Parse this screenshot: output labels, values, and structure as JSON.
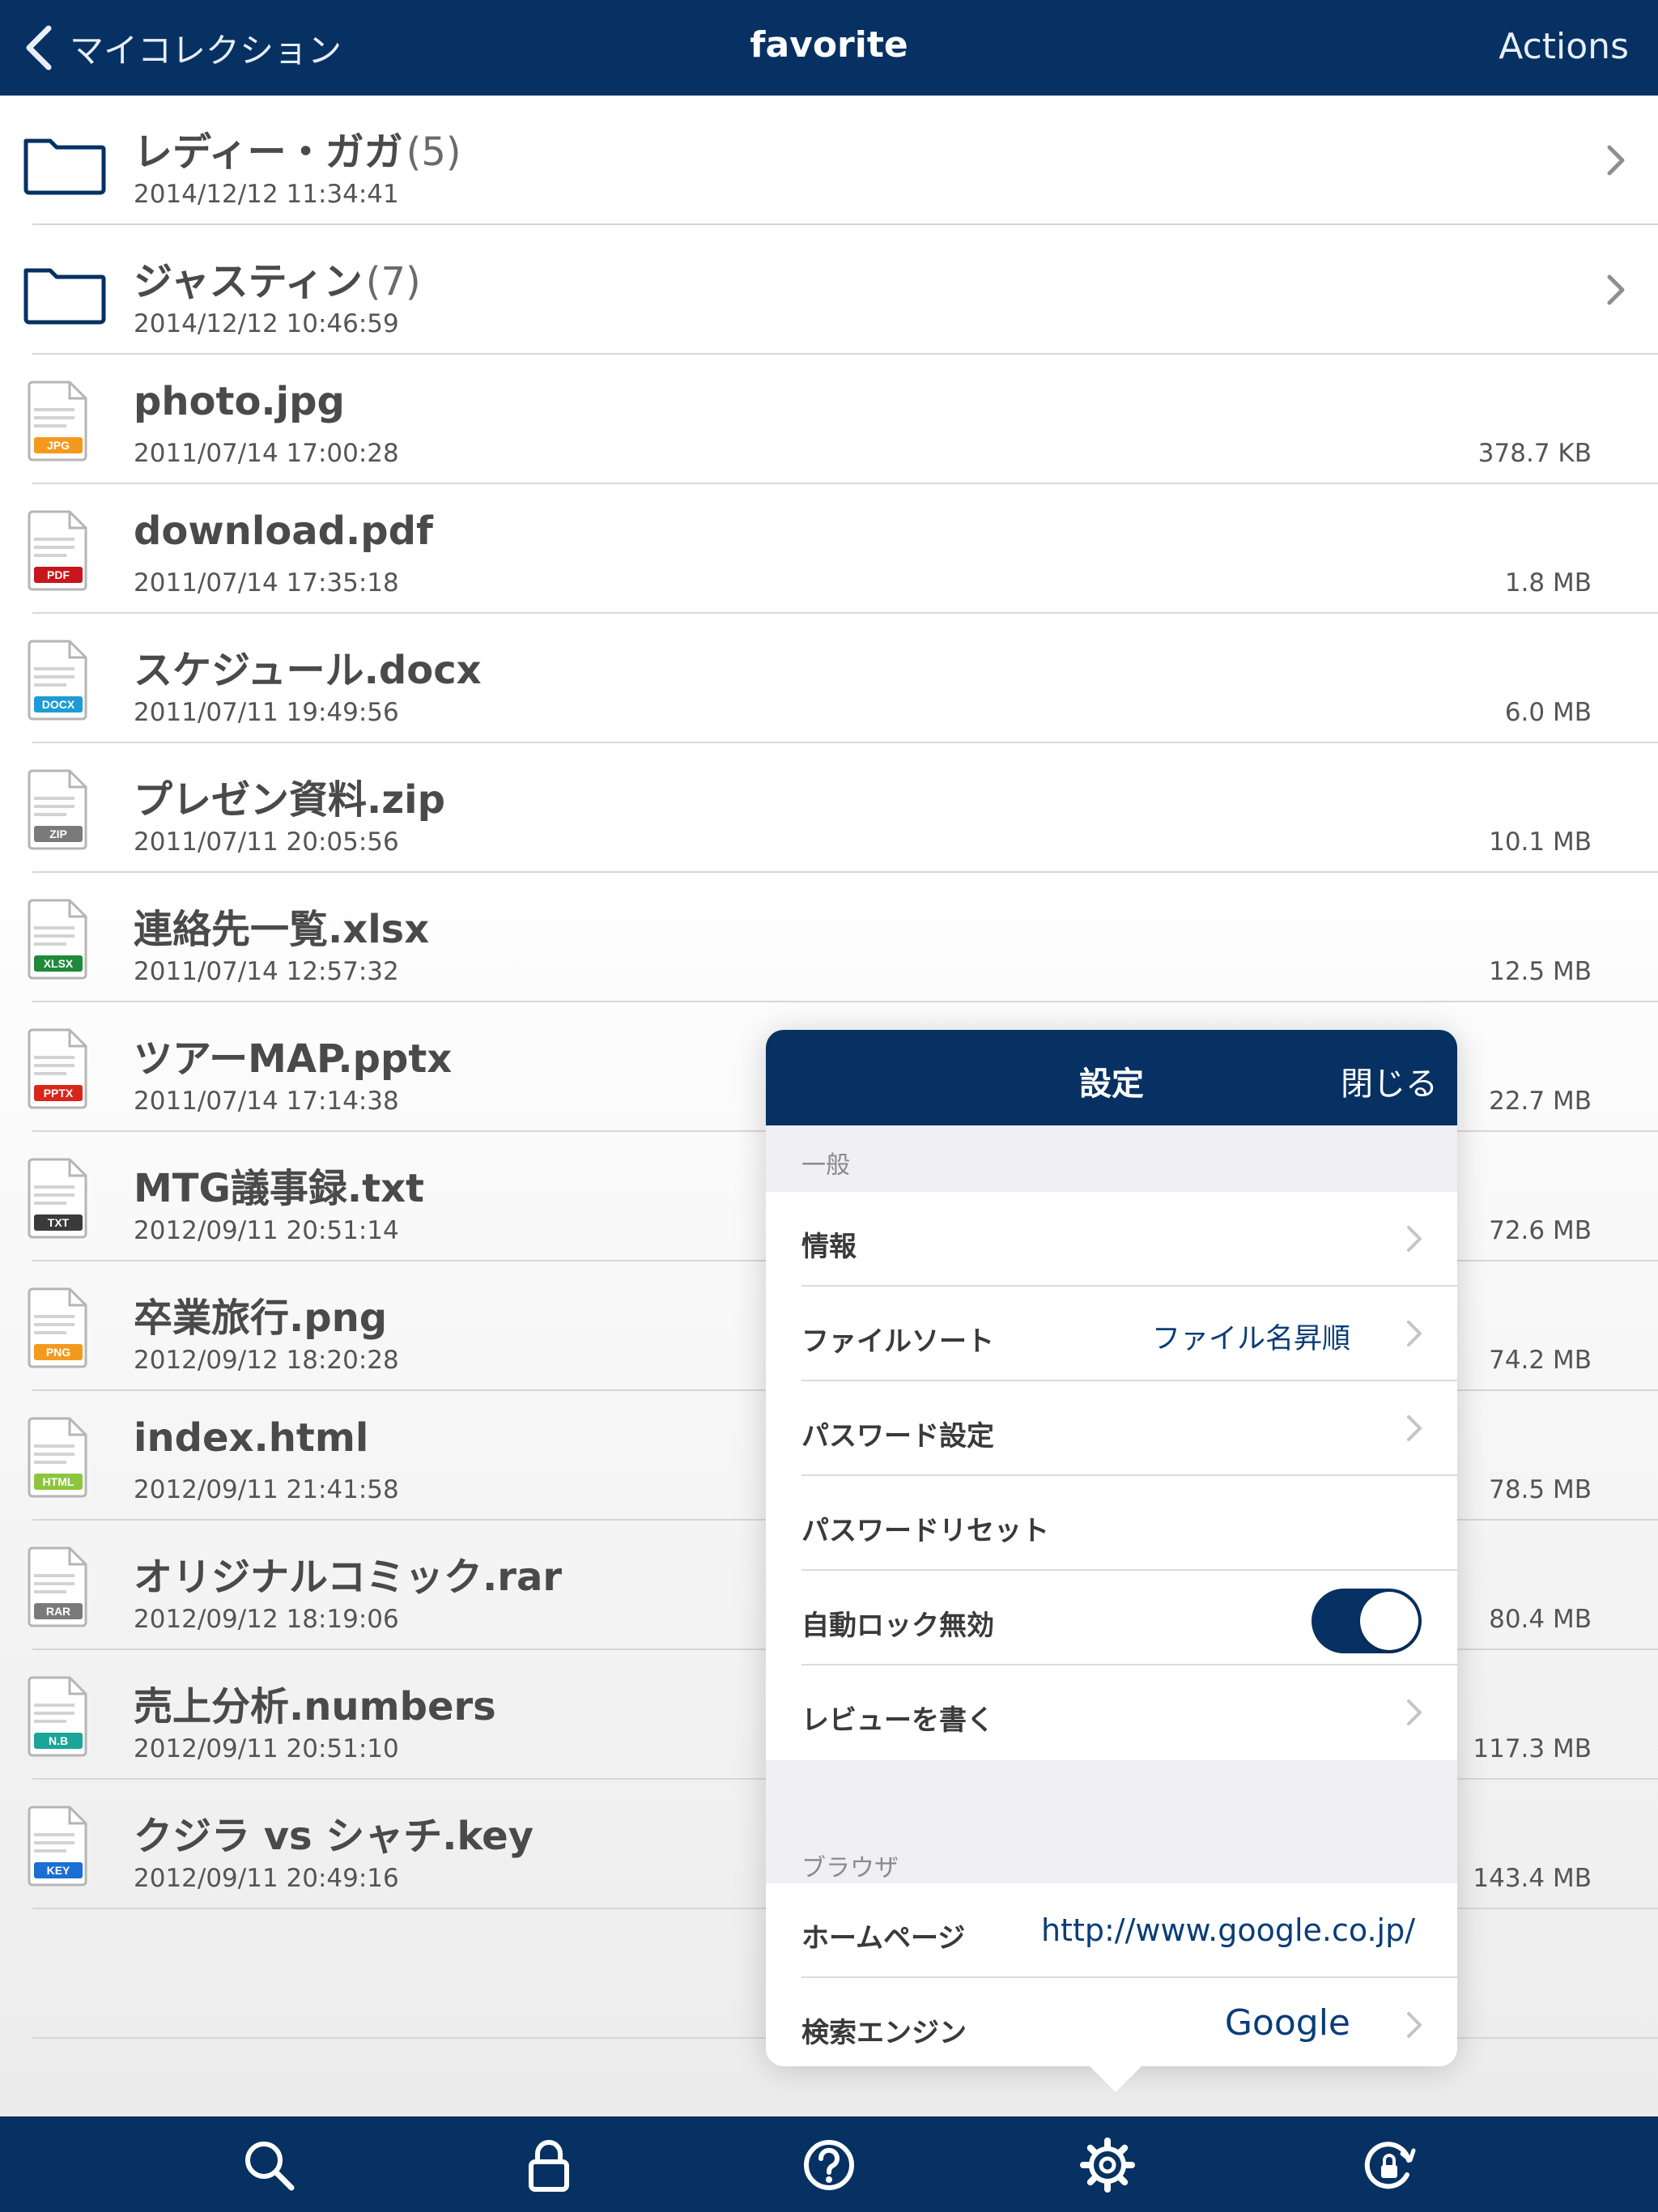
{
  "navbar": {
    "back_label": "マイコレクション",
    "title": "favorite",
    "actions_label": "Actions"
  },
  "items": [
    {
      "kind": "folder",
      "name": "レディー・ガガ",
      "count": "(5)",
      "date": "2014/12/12 11:34:41"
    },
    {
      "kind": "folder",
      "name": "ジャスティン",
      "count": "(7)",
      "date": "2014/12/12 10:46:59"
    },
    {
      "kind": "file",
      "name": "photo.jpg",
      "date": "2011/07/14 17:00:28",
      "size": "378.7 KB",
      "badge": "JPG",
      "badge_color": "#f39a1e",
      "icon": "image-file-icon"
    },
    {
      "kind": "file",
      "name": "download.pdf",
      "date": "2011/07/14 17:35:18",
      "size": "1.8 MB",
      "badge": "PDF",
      "badge_color": "#c8161d",
      "icon": "pdf-file-icon"
    },
    {
      "kind": "file",
      "name": "スケジュール.docx",
      "date": "2011/07/11 19:49:56",
      "size": "6.0 MB",
      "badge": "DOCX",
      "badge_color": "#1e9bd7",
      "icon": "document-file-icon"
    },
    {
      "kind": "file",
      "name": "プレゼン資料.zip",
      "date": "2011/07/11 20:05:56",
      "size": "10.1 MB",
      "badge": "ZIP",
      "badge_color": "#7a7a7a",
      "icon": "zip-file-icon"
    },
    {
      "kind": "file",
      "name": "連絡先一覧.xlsx",
      "date": "2011/07/14 12:57:32",
      "size": "12.5 MB",
      "badge": "XLSX",
      "badge_color": "#1f8a3a",
      "icon": "spreadsheet-file-icon"
    },
    {
      "kind": "file",
      "name": "ツアーMAP.pptx",
      "date": "2011/07/14 17:14:38",
      "size": "22.7 MB",
      "badge": "PPTX",
      "badge_color": "#d9261c",
      "icon": "presentation-file-icon"
    },
    {
      "kind": "file",
      "name": "MTG議事録.txt",
      "date": "2012/09/11 20:51:14",
      "size": "72.6 MB",
      "badge": "TXT",
      "badge_color": "#3a3a3a",
      "icon": "text-file-icon"
    },
    {
      "kind": "file",
      "name": "卒業旅行.png",
      "date": "2012/09/12 18:20:28",
      "size": "74.2 MB",
      "badge": "PNG",
      "badge_color": "#f39a1e",
      "icon": "image-file-icon"
    },
    {
      "kind": "file",
      "name": "index.html",
      "date": "2012/09/11 21:41:58",
      "size": "78.5 MB",
      "badge": "HTML",
      "badge_color": "#8cc63f",
      "icon": "html-file-icon"
    },
    {
      "kind": "file",
      "name": "オリジナルコミック.rar",
      "date": "2012/09/12 18:19:06",
      "size": "80.4 MB",
      "badge": "RAR",
      "badge_color": "#7a7a7a",
      "icon": "archive-file-icon"
    },
    {
      "kind": "file",
      "name": "売上分析.numbers",
      "date": "2012/09/11 20:51:10",
      "size": "117.3 MB",
      "badge": "N.B",
      "badge_color": "#1aa59a",
      "icon": "numbers-file-icon"
    },
    {
      "kind": "file",
      "name": "クジラ vs シャチ.key",
      "date": "2012/09/11 20:49:16",
      "size": "143.4 MB",
      "badge": "KEY",
      "badge_color": "#1b6ed4",
      "icon": "keynote-file-icon"
    }
  ],
  "settings": {
    "title": "設定",
    "close_label": "閉じる",
    "general_header": "一般",
    "general": {
      "info": "情報",
      "file_sort": "ファイルソート",
      "file_sort_value": "ファイル名昇順",
      "password_setting": "パスワード設定",
      "password_reset": "パスワードリセット",
      "auto_lock_disable": "自動ロック無効",
      "auto_lock_enabled": true,
      "write_review": "レビューを書く"
    },
    "browser_header": "ブラウザ",
    "browser": {
      "homepage": "ホームページ",
      "homepage_value": "http://www.google.co.jp/",
      "search_engine": "検索エンジン",
      "search_engine_value": "Google"
    }
  },
  "tabbar": {
    "icons": [
      "search-icon",
      "lock-icon",
      "help-icon",
      "settings-gear-icon",
      "lock-rotation-icon"
    ]
  },
  "colors": {
    "brand_navy": "#063162",
    "link_blue": "#0a3d78"
  }
}
